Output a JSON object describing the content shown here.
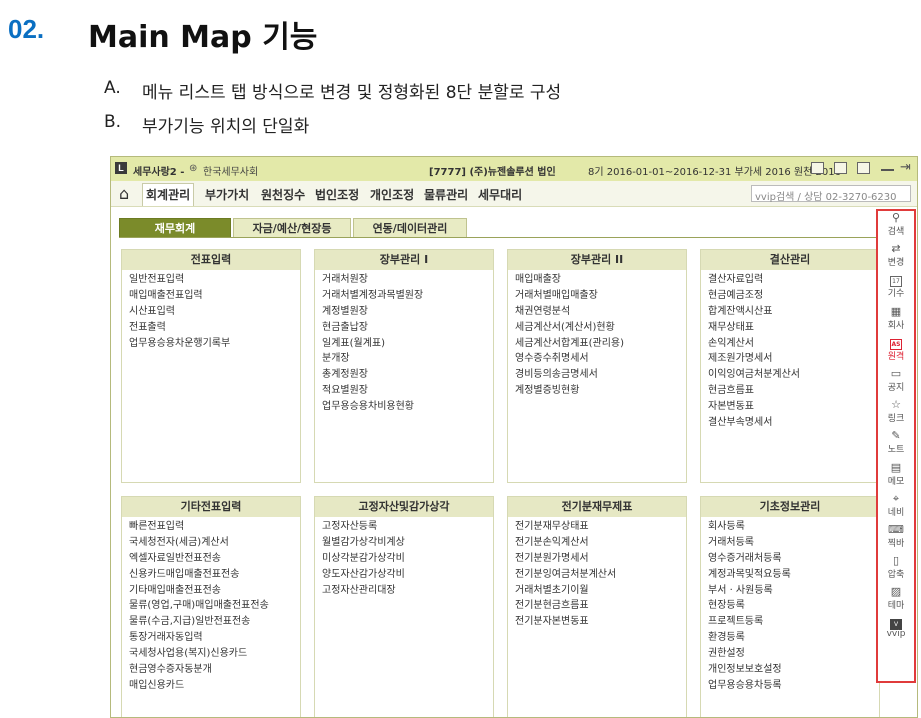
{
  "slide": {
    "number": "02.",
    "title": "Main Map 기능",
    "bullets": [
      {
        "marker": "A.",
        "text": "메뉴 리스트 탭 방식으로 변경 및 정형화된 8단 분할로 구성"
      },
      {
        "marker": "B.",
        "text": "부가기능 위치의 단일화"
      }
    ]
  },
  "app": {
    "logo": "L",
    "title": "세무사랑2 -",
    "association": "한국세무사회",
    "company": "[7777] (주)뉴젠솔루션 법인",
    "period": "8기 2016-01-01~2016-12-31 부가세 2016 원천 2016"
  },
  "menu": {
    "items": [
      "회계관리",
      "부가가치",
      "원천징수",
      "법인조정",
      "개인조정",
      "물류관리",
      "세무대리"
    ],
    "active": 0,
    "search_text": "vvip검색 / 상담 02-3270-6230"
  },
  "subtabs": [
    "재무회계",
    "자금/예산/현장등",
    "연동/데이터관리"
  ],
  "panels": [
    {
      "title": "전표입력",
      "items": [
        "일반전표입력",
        "매입매출전표입력",
        "시산표입력",
        "전표출력",
        "업무용승용차운행기록부"
      ]
    },
    {
      "title": "장부관리 I",
      "items": [
        "거래처원장",
        "거래처별계정과목별원장",
        "계정별원장",
        "현금출납장",
        "일계표(월계표)",
        "분개장",
        "총계정원장",
        "적요별원장",
        "업무용승용차비용현황"
      ]
    },
    {
      "title": "장부관리 II",
      "items": [
        "매입매출장",
        "거래처별매입매출장",
        "채권연령분석",
        "세금계산서(계산서)현황",
        "세금계산서합계표(관리용)",
        "영수증수취명세서",
        "경비등의송금명세서",
        "계정별증빙현황"
      ]
    },
    {
      "title": "결산관리",
      "items": [
        "결산자료입력",
        "현금예금조정",
        "합계잔액시산표",
        "재무상태표",
        "손익계산서",
        "제조원가명세서",
        "이익잉여금처분계산서",
        "현금흐름표",
        "자본변동표",
        "결산부속명세서"
      ]
    },
    {
      "title": "기타전표입력",
      "items": [
        "빠른전표입력",
        "국세청전자(세금)계산서",
        "엑셀자료일반전표전송",
        "신용카드매입매출전표전송",
        "기타매입매출전표전송",
        "물류(영업,구매)매입매출전표전송",
        "물류(수금,지급)일반전표전송",
        "통장거래자동입력",
        "국세청사업용(복지)신용카드",
        "현금영수증자동분개",
        "매입신용카드"
      ]
    },
    {
      "title": "고정자산및감가상각",
      "items": [
        "고정자산등록",
        "월별감가상각비계상",
        "미상각분감가상각비",
        "양도자산감가상각비",
        "고정자산관리대장"
      ]
    },
    {
      "title": "전기분재무제표",
      "items": [
        "전기분재무상태표",
        "전기분손익계산서",
        "전기분원가명세서",
        "전기분잉여금처분계산서",
        "거래처별초기이월",
        "전기분현금흐름표",
        "전기분자본변동표"
      ]
    },
    {
      "title": "기초정보관리",
      "items": [
        "회사등록",
        "거래처등록",
        "영수증거래처등록",
        "계정과목및적요등록",
        "부서 · 사원등록",
        "현장등록",
        "프로젝트등록",
        "환경등록",
        "권한설정",
        "개인정보보호설정",
        "업무용승용차등록"
      ]
    }
  ],
  "quickbar": [
    {
      "icon": "search-icon",
      "glyph": "⚲",
      "label": "검색"
    },
    {
      "icon": "change-icon",
      "glyph": "⇄",
      "label": "변경"
    },
    {
      "icon": "calendar-icon",
      "glyph": "17",
      "label": "기수"
    },
    {
      "icon": "building-icon",
      "glyph": "▦",
      "label": "회사"
    },
    {
      "icon": "remote-icon",
      "glyph": "AS",
      "label": "원격",
      "accent": "#dd2233"
    },
    {
      "icon": "notice-icon",
      "glyph": "▭",
      "label": "공지"
    },
    {
      "icon": "star-icon",
      "glyph": "☆",
      "label": "링크"
    },
    {
      "icon": "note-icon",
      "glyph": "✎",
      "label": "노트"
    },
    {
      "icon": "memo-icon",
      "glyph": "▤",
      "label": "메모"
    },
    {
      "icon": "navi-icon",
      "glyph": "⌖",
      "label": "네비"
    },
    {
      "icon": "shortcut-icon",
      "glyph": "⌨",
      "label": "찍바"
    },
    {
      "icon": "compress-icon",
      "glyph": "▯",
      "label": "압축"
    },
    {
      "icon": "theme-icon",
      "glyph": "▨",
      "label": "테마"
    },
    {
      "icon": "vvip-icon",
      "glyph": "V",
      "label": "vvip"
    }
  ],
  "colors": {
    "slide_number": "#0a6fc2",
    "titlebar": "#e3e9a9",
    "active_subtab": "#7b8b2a",
    "panel_header": "#e6e8c4",
    "highlight_border": "#e03b3b"
  }
}
